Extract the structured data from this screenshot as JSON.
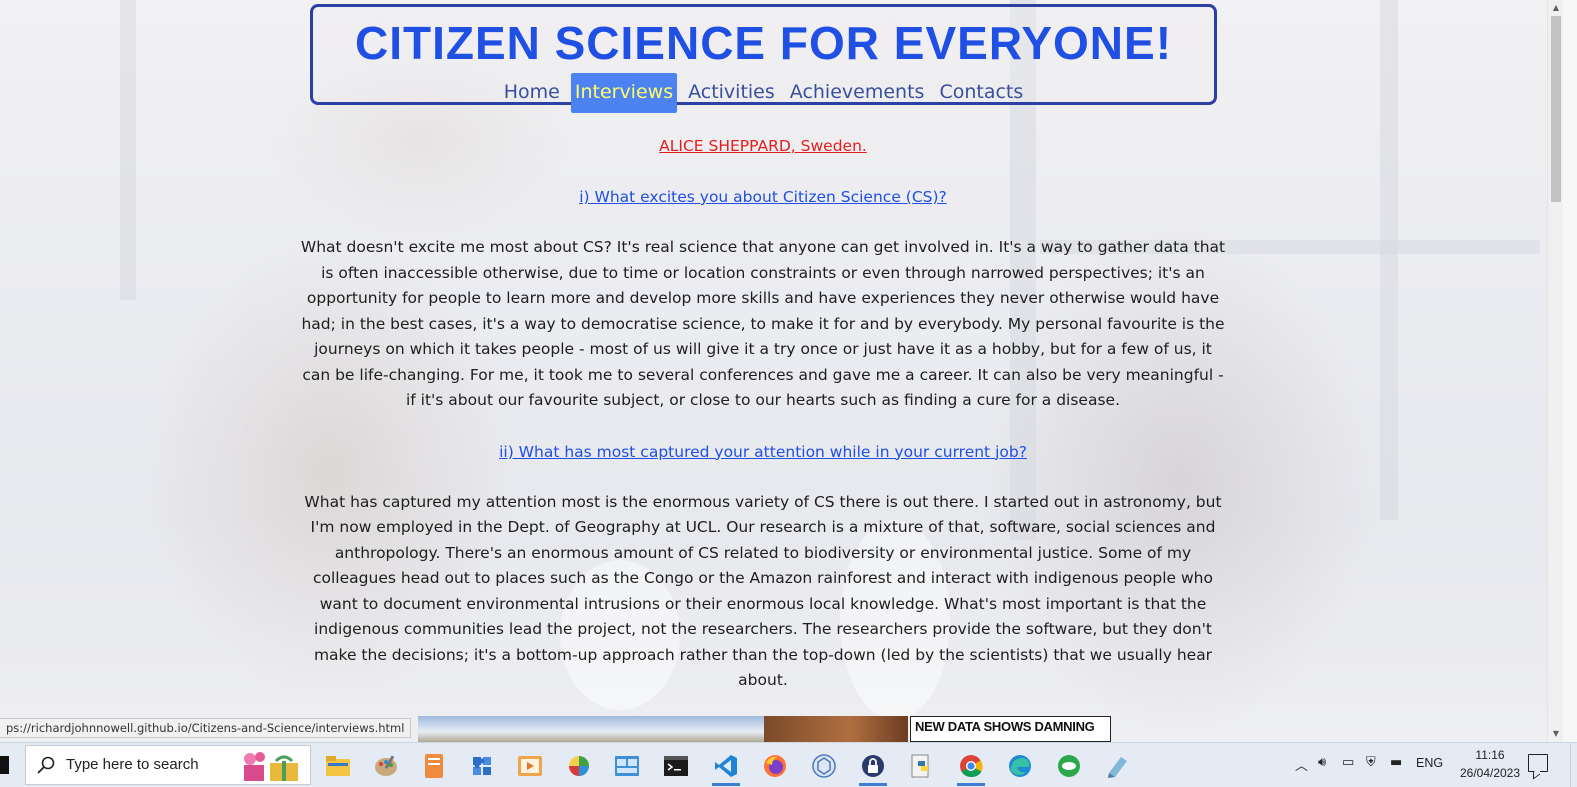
{
  "site": {
    "title": "CITIZEN SCIENCE FOR EVERYONE!",
    "nav": [
      {
        "label": "Home",
        "active": false
      },
      {
        "label": "Interviews",
        "active": true
      },
      {
        "label": "Activities",
        "active": false
      },
      {
        "label": "Achievements",
        "active": false
      },
      {
        "label": "Contacts",
        "active": false
      }
    ]
  },
  "interview": {
    "interviewee": "ALICE SHEPPARD, Sweden.",
    "q1": "i) What excites you about Citizen Science (CS)?",
    "a1": "What doesn't excite me most about CS? It's real science that anyone can get involved in. It's a way to gather data that is often inaccessible otherwise, due to time or location constraints or even through narrowed perspectives; it's an opportunity for people to learn more and develop more skills and have experiences they never otherwise would have had; in the best cases, it's a way to democratise science, to make it for and by everybody. My personal favourite is the journeys on which it takes people - most of us will give it a try once or just have it as a hobby, but for a few of us, it can be life-changing. For me, it took me to several conferences and gave me a career. It can also be very meaningful - if it's about our favourite subject, or close to our hearts such as finding a cure for a disease.",
    "q2": "ii) What has most captured your attention while in your current job?",
    "a2": "What has captured my attention most is the enormous variety of CS there is out there. I started out in astronomy, but I'm now employed in the Dept. of Geography at UCL. Our research is a mixture of that, software, social sciences and anthropology. There's an enormous amount of CS related to biodiversity or environmental justice. Some of my colleagues head out to places such as the Congo or the Amazon rainforest and interact with indigenous people who want to document environmental intrusions or their enormous local knowledge. What's most important is that the indigenous communities lead the project, not the researchers. The researchers provide the software, but they don't make the decisions; it's a bottom-up approach rather than the top-down (led by the scientists) that we usually hear about."
  },
  "browser": {
    "status_url": "ps://richardjohnnowell.github.io/Citizens-and-Science/interviews.html",
    "news_thumb_text": "NEW DATA SHOWS DAMNING"
  },
  "taskbar": {
    "search_placeholder": "Type here to search",
    "apps": [
      {
        "icon": "file-explorer-icon",
        "running": false
      },
      {
        "icon": "paint-palette-icon",
        "running": false
      },
      {
        "icon": "document-reader-icon",
        "running": false
      },
      {
        "icon": "puzzle-app-icon",
        "running": false
      },
      {
        "icon": "media-player-icon",
        "running": false
      },
      {
        "icon": "color-picker-icon",
        "running": false
      },
      {
        "icon": "control-panel-icon",
        "running": false
      },
      {
        "icon": "terminal-icon",
        "running": false
      },
      {
        "icon": "vscode-icon",
        "running": true
      },
      {
        "icon": "firefox-icon",
        "running": false
      },
      {
        "icon": "network-app-icon",
        "running": false
      },
      {
        "icon": "vpn-lock-icon",
        "running": true
      },
      {
        "icon": "python-icon",
        "running": false
      },
      {
        "icon": "chrome-icon",
        "running": true
      },
      {
        "icon": "edge-icon",
        "running": false
      },
      {
        "icon": "chat-app-icon",
        "running": false
      },
      {
        "icon": "tool-app-icon",
        "running": false
      }
    ],
    "language": "ENG",
    "time": "11:16",
    "date": "26/04/2023"
  },
  "colors": {
    "title_blue": "#1f4fe3",
    "nav_active_bg": "#4c82f2",
    "nav_active_text": "#ffff66",
    "interviewee_red": "#e31e1e",
    "header_border": "#2d3fa3"
  }
}
